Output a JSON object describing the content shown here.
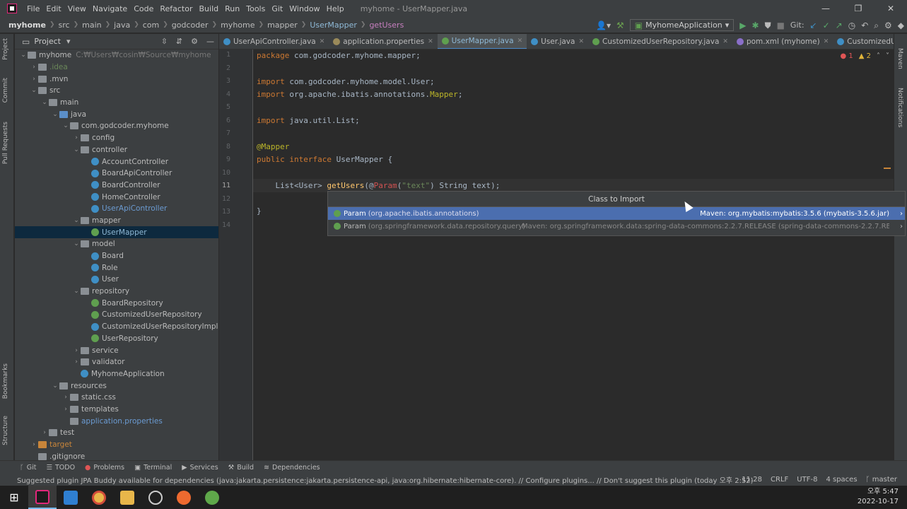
{
  "menu": {
    "items": [
      "File",
      "Edit",
      "View",
      "Navigate",
      "Code",
      "Refactor",
      "Build",
      "Run",
      "Tools",
      "Git",
      "Window",
      "Help"
    ],
    "window_title": "myhome - UserMapper.java"
  },
  "breadcrumb": [
    "myhome",
    "src",
    "main",
    "java",
    "com",
    "godcoder",
    "myhome",
    "mapper",
    "UserMapper",
    "getUsers"
  ],
  "run_config": "MyhomeApplication",
  "git_label": "Git:",
  "project_panel": {
    "title": "Project",
    "tree": [
      {
        "label": "myhome",
        "hint": "C:₩Users₩cosin₩Source₩myhome",
        "indent": 0,
        "arrow": "v",
        "icon": "folder"
      },
      {
        "label": ".idea",
        "indent": 1,
        "arrow": ">",
        "icon": "folder"
      },
      {
        "label": ".mvn",
        "indent": 1,
        "arrow": ">",
        "icon": "folder"
      },
      {
        "label": "src",
        "indent": 1,
        "arrow": "v",
        "icon": "folder"
      },
      {
        "label": "main",
        "indent": 2,
        "arrow": "v",
        "icon": "folder"
      },
      {
        "label": "java",
        "indent": 3,
        "arrow": "v",
        "icon": "folder blue"
      },
      {
        "label": "com.godcoder.myhome",
        "indent": 4,
        "arrow": "v",
        "icon": "folder"
      },
      {
        "label": "config",
        "indent": 5,
        "arrow": ">",
        "icon": "folder"
      },
      {
        "label": "controller",
        "indent": 5,
        "arrow": "v",
        "icon": "folder"
      },
      {
        "label": "AccountController",
        "indent": 6,
        "arrow": "",
        "icon": "cls"
      },
      {
        "label": "BoardApiController",
        "indent": 6,
        "arrow": "",
        "icon": "cls"
      },
      {
        "label": "BoardController",
        "indent": 6,
        "arrow": "",
        "icon": "cls"
      },
      {
        "label": "HomeController",
        "indent": 6,
        "arrow": "",
        "icon": "cls"
      },
      {
        "label": "UserApiController",
        "indent": 6,
        "arrow": "",
        "icon": "cls"
      },
      {
        "label": "mapper",
        "indent": 5,
        "arrow": "v",
        "icon": "folder"
      },
      {
        "label": "UserMapper",
        "indent": 6,
        "arrow": "",
        "icon": "cls g",
        "selected": true
      },
      {
        "label": "model",
        "indent": 5,
        "arrow": "v",
        "icon": "folder"
      },
      {
        "label": "Board",
        "indent": 6,
        "arrow": "",
        "icon": "cls"
      },
      {
        "label": "Role",
        "indent": 6,
        "arrow": "",
        "icon": "cls"
      },
      {
        "label": "User",
        "indent": 6,
        "arrow": "",
        "icon": "cls"
      },
      {
        "label": "repository",
        "indent": 5,
        "arrow": "v",
        "icon": "folder"
      },
      {
        "label": "BoardRepository",
        "indent": 6,
        "arrow": "",
        "icon": "cls g"
      },
      {
        "label": "CustomizedUserRepository",
        "indent": 6,
        "arrow": "",
        "icon": "cls g"
      },
      {
        "label": "CustomizedUserRepositoryImpl",
        "indent": 6,
        "arrow": "",
        "icon": "cls"
      },
      {
        "label": "UserRepository",
        "indent": 6,
        "arrow": "",
        "icon": "cls g"
      },
      {
        "label": "service",
        "indent": 5,
        "arrow": ">",
        "icon": "folder"
      },
      {
        "label": "validator",
        "indent": 5,
        "arrow": ">",
        "icon": "folder"
      },
      {
        "label": "MyhomeApplication",
        "indent": 5,
        "arrow": "",
        "icon": "cls"
      },
      {
        "label": "resources",
        "indent": 3,
        "arrow": "v",
        "icon": "folder"
      },
      {
        "label": "static.css",
        "indent": 4,
        "arrow": ">",
        "icon": "folder"
      },
      {
        "label": "templates",
        "indent": 4,
        "arrow": ">",
        "icon": "folder"
      },
      {
        "label": "application.properties",
        "indent": 4,
        "arrow": "",
        "icon": "folder"
      },
      {
        "label": "test",
        "indent": 2,
        "arrow": ">",
        "icon": "folder"
      },
      {
        "label": "target",
        "indent": 1,
        "arrow": ">",
        "icon": "folder orange"
      },
      {
        "label": ".gitignore",
        "indent": 1,
        "arrow": "",
        "icon": "folder"
      }
    ]
  },
  "tabs": [
    {
      "label": "UserApiController.java",
      "color": "#3f8fc5",
      "active": false
    },
    {
      "label": "application.properties",
      "color": "#9a8a5a",
      "active": false
    },
    {
      "label": "UserMapper.java",
      "color": "#5f9f4f",
      "active": true
    },
    {
      "label": "User.java",
      "color": "#3f8fc5",
      "active": false
    },
    {
      "label": "CustomizedUserRepository.java",
      "color": "#5f9f4f",
      "active": false
    },
    {
      "label": "pom.xml (myhome)",
      "color": "#8a6fc9",
      "active": false
    },
    {
      "label": "CustomizedUserRep",
      "color": "#3f8fc5",
      "active": false
    }
  ],
  "editor": {
    "line_numbers": [
      "1",
      "2",
      "3",
      "4",
      "5",
      "6",
      "7",
      "8",
      "9",
      "10",
      "11",
      "12",
      "13",
      "14"
    ],
    "errors": "1",
    "warnings": "2"
  },
  "popup": {
    "title": "Class to Import",
    "rows": [
      {
        "name": "Param",
        "pkg": "(org.apache.ibatis.annotations)",
        "source": "Maven: org.mybatis:mybatis:3.5.6 (mybatis-3.5.6.jar)"
      },
      {
        "name": "Param",
        "pkg": "(org.springframework.data.repository.query)",
        "source": "Maven: org.springframework.data:spring-data-commons:2.2.7.RELEASE (spring-data-commons-2.2.7.RELEASE.jar)"
      }
    ]
  },
  "left_tool_tabs": [
    "Project",
    "Commit",
    "Pull Requests",
    "Bookmarks",
    "Structure"
  ],
  "right_tool_tabs": [
    "Maven",
    "Notifications"
  ],
  "bottom_tools": [
    "Git",
    "TODO",
    "Problems",
    "Terminal",
    "Services",
    "Build",
    "Dependencies"
  ],
  "status": {
    "message": "Suggested plugin JPA Buddy available for dependencies (java:jakarta.persistence:jakarta.persistence-api, java:org.hibernate:hibernate-core). // Configure plugins... // Don't suggest this plugin (today 오후 2:52)",
    "position": "11:28",
    "line_sep": "CRLF",
    "encoding": "UTF-8",
    "indent": "4 spaces",
    "branch": "master"
  },
  "clock": {
    "time": "오후 5:47",
    "date": "2022-10-17"
  }
}
